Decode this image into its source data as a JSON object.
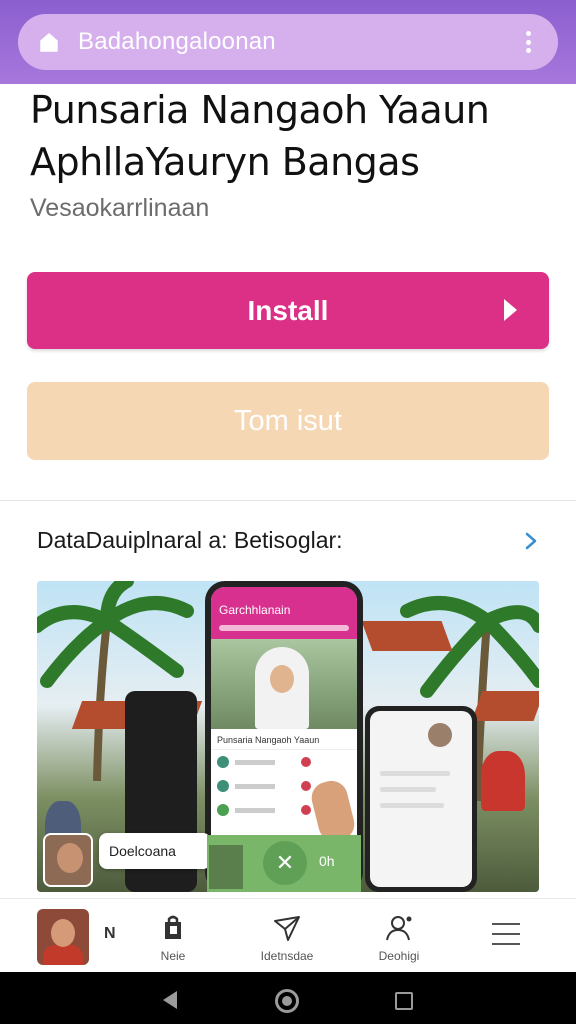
{
  "header": {
    "title": "Badahongaloonan",
    "bg_color": "#8b5fcf"
  },
  "app": {
    "title": "Punsaria Nangaoh Yaaun AphllaYauryn Bangas",
    "subtitle": "Vesaokarrlinaan",
    "install_label": "Install",
    "trial_label": "Tom isut",
    "install_color": "#dc2f86",
    "trial_color": "#f6d7b4"
  },
  "screenshots": {
    "section_title": "DataDauiplnaral a: Betisoglar:",
    "phone_header": "Garchhlanain",
    "phone_caption": "Punsaria Nangaoh Yaaun",
    "toast_label": "Doelcoana",
    "confirm_label": "0h"
  },
  "bottom_nav": {
    "thumb_label": "N",
    "items": [
      {
        "label": "Neie",
        "icon": "bag-icon"
      },
      {
        "label": "Idetnsdae",
        "icon": "send-icon"
      },
      {
        "label": "Deohigi",
        "icon": "person-add-icon"
      }
    ],
    "menu_icon": "menu-icon"
  },
  "system_nav": {
    "back_icon": "back-icon",
    "home_icon": "home-circle-icon",
    "recents_icon": "recents-icon"
  }
}
